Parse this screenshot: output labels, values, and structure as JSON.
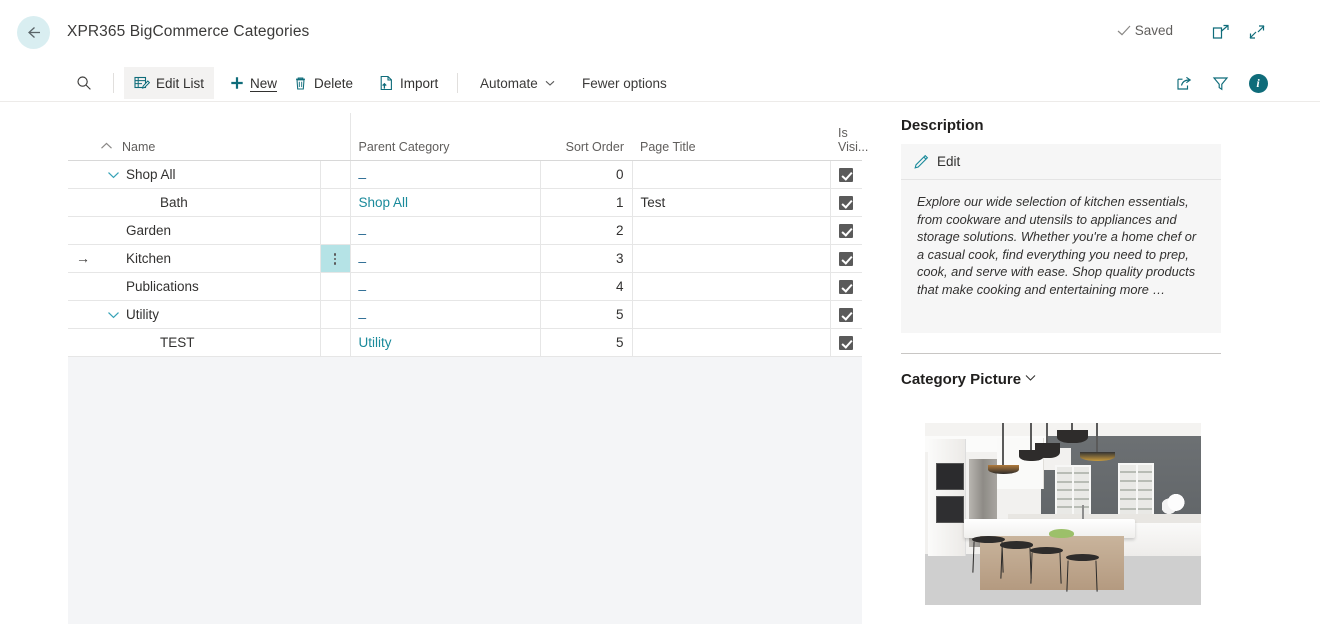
{
  "window": {
    "title": "XPR365 BigCommerce Categories",
    "saved_label": "Saved",
    "back_icon": "back-arrow-icon",
    "popout_icon": "open-in-new-window-icon",
    "collapse_icon": "collapse-icon"
  },
  "toolbar": {
    "search_icon": "search-icon",
    "items": [
      {
        "label": "Edit List",
        "icon": "edit-list-icon",
        "active": true
      },
      {
        "label": "New",
        "icon": "plus-icon",
        "active": false
      },
      {
        "label": "Delete",
        "icon": "trash-icon",
        "active": false
      },
      {
        "label": "Import",
        "icon": "import-file-icon",
        "active": false
      },
      {
        "label": "Automate",
        "icon": "chevron-down-icon",
        "active": false
      },
      {
        "label": "Fewer options",
        "icon": "",
        "active": false
      }
    ],
    "right_icons": [
      {
        "name": "share-icon"
      },
      {
        "name": "filter-icon"
      },
      {
        "name": "info-icon",
        "glyph": "i"
      }
    ]
  },
  "grid": {
    "columns": [
      {
        "key": "name",
        "label": "Name",
        "sort": "ascending"
      },
      {
        "key": "parent",
        "label": "Parent Category"
      },
      {
        "key": "sort",
        "label": "Sort Order"
      },
      {
        "key": "page",
        "label": "Page Title"
      },
      {
        "key": "visible",
        "label_line1": "Is",
        "label_line2": "Visi..."
      }
    ],
    "rows": [
      {
        "name": "Shop All",
        "level": 0,
        "expandable": true,
        "parent": "_",
        "parent_is_link": false,
        "sort": "0",
        "page": "",
        "visible": true,
        "selected": false
      },
      {
        "name": "Bath",
        "level": 1,
        "expandable": false,
        "parent": "Shop All",
        "parent_is_link": true,
        "sort": "1",
        "page": "Test",
        "visible": true,
        "selected": false
      },
      {
        "name": "Garden",
        "level": 0,
        "expandable": false,
        "parent": "_",
        "parent_is_link": false,
        "sort": "2",
        "page": "",
        "visible": true,
        "selected": false
      },
      {
        "name": "Kitchen",
        "level": 0,
        "expandable": false,
        "parent": "_",
        "parent_is_link": false,
        "sort": "3",
        "page": "",
        "visible": true,
        "selected": true
      },
      {
        "name": "Publications",
        "level": 0,
        "expandable": false,
        "parent": "_",
        "parent_is_link": false,
        "sort": "4",
        "page": "",
        "visible": true,
        "selected": false
      },
      {
        "name": "Utility",
        "level": 0,
        "expandable": true,
        "parent": "_",
        "parent_is_link": false,
        "sort": "5",
        "page": "",
        "visible": true,
        "selected": false
      },
      {
        "name": "TEST",
        "level": 1,
        "expandable": false,
        "parent": "Utility",
        "parent_is_link": true,
        "sort": "5",
        "page": "",
        "visible": true,
        "selected": false
      }
    ]
  },
  "factbox": {
    "description": {
      "title": "Description",
      "edit_label": "Edit",
      "edit_icon": "pencil-icon",
      "text": "Explore our wide selection of kitchen essentials, from cookware and utensils to appliances and storage solutions. Whether you're a home chef or a casual cook, find everything you need to prep, cook, and serve with ease. Shop quality products that make cooking and entertaining more …"
    },
    "picture": {
      "title": "Category Picture",
      "chevron_icon": "chevron-down-icon",
      "image_alt": "modern-kitchen-photo"
    }
  },
  "colors": {
    "accent": "#0f6c7a",
    "link": "#1a8a9b",
    "selection": "#b5e3e6",
    "back_button_bg": "#d9eef1"
  }
}
